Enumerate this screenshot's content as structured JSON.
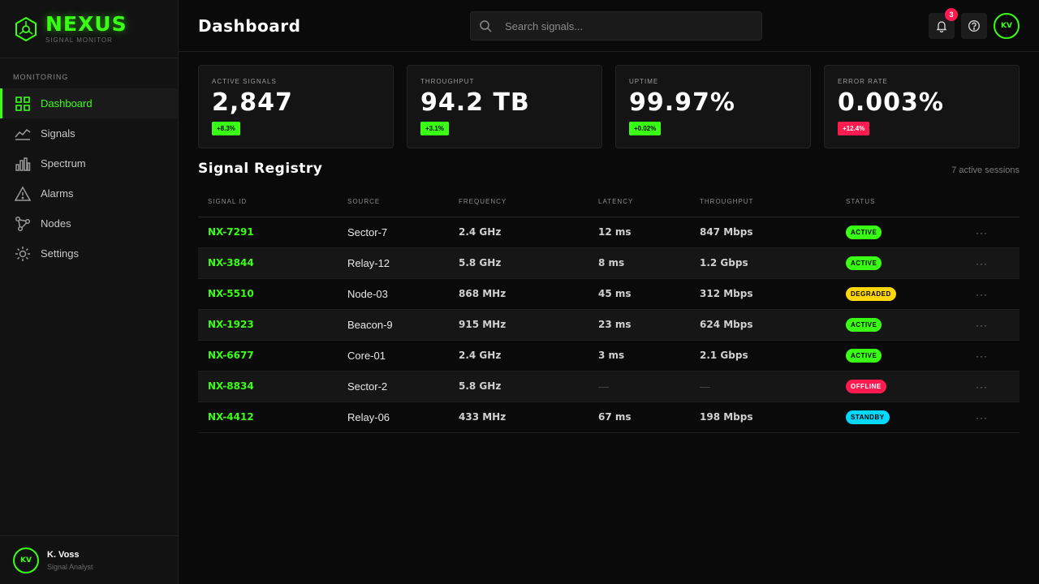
{
  "brand": {
    "name": "NEXUS",
    "subtitle": "SIGNAL MONITOR"
  },
  "sidebar": {
    "section": "MONITORING",
    "items": [
      {
        "label": "Dashboard",
        "icon": "grid-icon",
        "active": true
      },
      {
        "label": "Signals",
        "icon": "line-chart-icon"
      },
      {
        "label": "Spectrum",
        "icon": "bar-chart-icon"
      },
      {
        "label": "Alarms",
        "icon": "warning-icon"
      },
      {
        "label": "Nodes",
        "icon": "network-icon"
      },
      {
        "label": "Settings",
        "icon": "gear-icon"
      }
    ]
  },
  "user": {
    "initials": "KV",
    "name": "K. Voss",
    "role": "Signal Analyst"
  },
  "header": {
    "title": "Dashboard",
    "search_placeholder": "Search signals...",
    "notifications_count": "3",
    "avatar_initials": "KV"
  },
  "stats": [
    {
      "label": "ACTIVE SIGNALS",
      "value": "2,847",
      "delta": "+8.3%",
      "tone": "good"
    },
    {
      "label": "THROUGHPUT",
      "value": "94.2 TB",
      "delta": "+3.1%",
      "tone": "good"
    },
    {
      "label": "UPTIME",
      "value": "99.97%",
      "delta": "+0.02%",
      "tone": "good"
    },
    {
      "label": "ERROR RATE",
      "value": "0.003%",
      "delta": "+12.4%",
      "tone": "bad"
    }
  ],
  "registry": {
    "title": "Signal Registry",
    "count_text": "7 active sessions",
    "columns": [
      "SIGNAL ID",
      "SOURCE",
      "FREQUENCY",
      "LATENCY",
      "THROUGHPUT",
      "STATUS"
    ],
    "rows": [
      {
        "id": "NX-7291",
        "source": "Sector-7",
        "frequency": "2.4 GHz",
        "latency": "12 ms",
        "throughput": "847 Mbps",
        "status": "ACTIVE"
      },
      {
        "id": "NX-3844",
        "source": "Relay-12",
        "frequency": "5.8 GHz",
        "latency": "8 ms",
        "throughput": "1.2 Gbps",
        "status": "ACTIVE"
      },
      {
        "id": "NX-5510",
        "source": "Node-03",
        "frequency": "868 MHz",
        "latency": "45 ms",
        "throughput": "312 Mbps",
        "status": "DEGRADED"
      },
      {
        "id": "NX-1923",
        "source": "Beacon-9",
        "frequency": "915 MHz",
        "latency": "23 ms",
        "throughput": "624 Mbps",
        "status": "ACTIVE"
      },
      {
        "id": "NX-6677",
        "source": "Core-01",
        "frequency": "2.4 GHz",
        "latency": "3 ms",
        "throughput": "2.1 Gbps",
        "status": "ACTIVE"
      },
      {
        "id": "NX-8834",
        "source": "Sector-2",
        "frequency": "5.8 GHz",
        "latency": "—",
        "throughput": "—",
        "status": "OFFLINE"
      },
      {
        "id": "NX-4412",
        "source": "Relay-06",
        "frequency": "433 MHz",
        "latency": "67 ms",
        "throughput": "198 Mbps",
        "status": "STANDBY"
      }
    ],
    "row_action": "···"
  },
  "colors": {
    "accent": "#39ff14",
    "danger": "#ff1a4f",
    "warning": "#ffd60a",
    "info": "#00d9ff"
  }
}
